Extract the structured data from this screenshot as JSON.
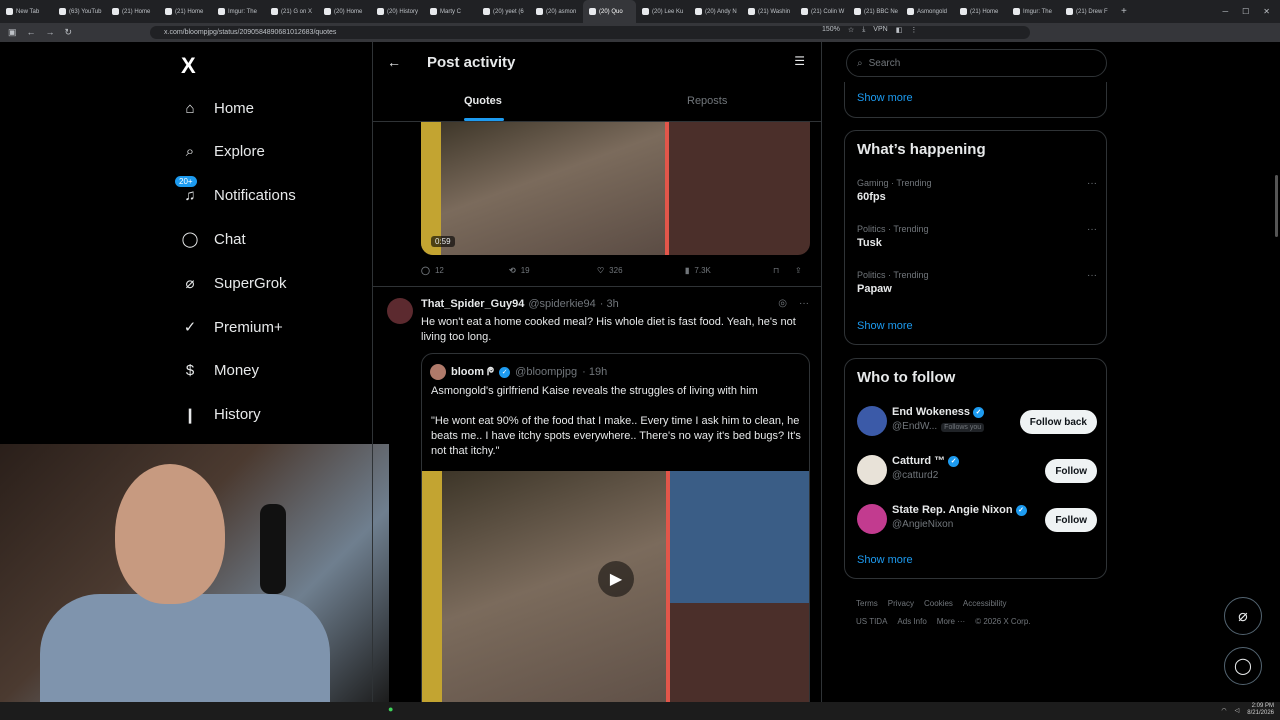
{
  "browser": {
    "tabs": [
      "New Tab",
      "(63) YouTub",
      "(21) Home",
      "(21) Home",
      "Imgur: The",
      "(21) G on X",
      "(20) Home",
      "(20) History",
      "Marty C",
      "(20) yeet (6",
      "(20) asmon",
      "(20) Quo",
      "(20) Lee Ku",
      "(20) Andy N",
      "(21) Washin",
      "(21) Colin W",
      "(21) BBC Ne",
      "Asmongold",
      "(21) Home",
      "Imgur: The",
      "(21) Drew F"
    ],
    "active_tab_index": 11,
    "url": "x.com/bloompjpg/status/2090584890681012683/quotes",
    "zoom": "150%",
    "vpn": "VPN"
  },
  "sidebar": {
    "logo": "X",
    "items": [
      {
        "label": "Home",
        "icon": "home-icon"
      },
      {
        "label": "Explore",
        "icon": "search-icon"
      },
      {
        "label": "Notifications",
        "icon": "bell-icon",
        "badge": "20+"
      },
      {
        "label": "Chat",
        "icon": "chat-icon"
      },
      {
        "label": "SuperGrok",
        "icon": "grok-icon"
      },
      {
        "label": "Premium+",
        "icon": "verified-icon"
      },
      {
        "label": "Money",
        "icon": "dollar-icon"
      },
      {
        "label": "History",
        "icon": "bookmark-icon"
      }
    ]
  },
  "header": {
    "title": "Post activity",
    "tabs": [
      "Quotes",
      "Reposts"
    ]
  },
  "post1": {
    "duration": "0:59",
    "replies": "12",
    "reposts": "19",
    "likes": "326",
    "views": "7.3K"
  },
  "post2": {
    "name": "That_Spider_Guy94",
    "handle": "@spiderkie94",
    "time": "· 3h",
    "text": "He won't eat a home cooked meal? His whole diet is fast food. Yeah, he's not living too long.",
    "quote": {
      "name": "bloom ᖘ",
      "handle": "@bloompjpg",
      "time": "· 19h",
      "text1": "Asmongold's girlfriend Kaise reveals the struggles of living with him",
      "text2": "\"He wont eat 90% of the food that I make.. Every time I ask him to clean, he beats me.. I have itchy spots everywhere.. There's no way it's bed bugs? It's not that itchy.\""
    }
  },
  "right": {
    "search_placeholder": "Search",
    "show_more": "Show more",
    "happening_title": "What’s happening",
    "trends": [
      {
        "category": "Gaming · Trending",
        "title": "60fps"
      },
      {
        "category": "Politics · Trending",
        "title": "Tusk"
      },
      {
        "category": "Politics · Trending",
        "title": "Papaw"
      }
    ],
    "wtf_title": "Who to follow",
    "follow": [
      {
        "name": "End Wokeness",
        "handle": "@EndW...",
        "follows_you": "Follows you",
        "button": "Follow back",
        "color": "#3b5aa8"
      },
      {
        "name": "Catturd ™",
        "handle": "@catturd2",
        "button": "Follow",
        "color": "#e8e2d8"
      },
      {
        "name": "State Rep. Angie Nixon",
        "handle": "@AngieNixon",
        "button": "Follow",
        "color": "#c23b8f"
      }
    ],
    "footer": [
      "Terms",
      "Privacy",
      "Cookies",
      "Accessibility",
      "US TIDA",
      "Ads Info",
      "More ···",
      "© 2026 X Corp."
    ]
  },
  "taskbar": {
    "time": "2:09 PM",
    "date": "8/21/2026"
  }
}
